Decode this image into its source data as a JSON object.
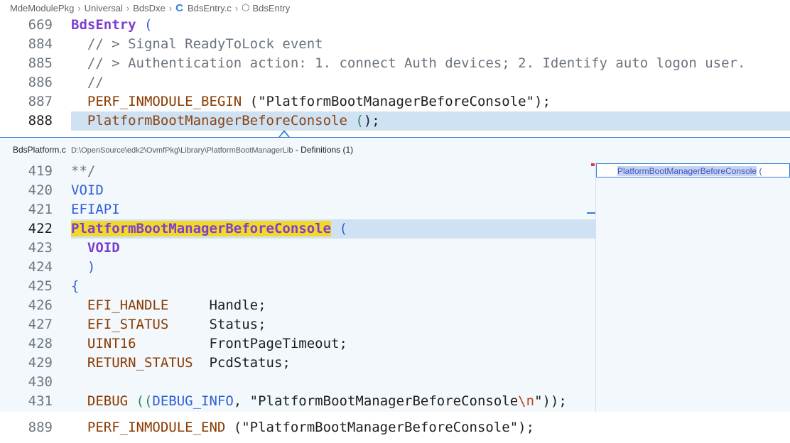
{
  "breadcrumb": {
    "items": [
      "MdeModulePkg",
      "Universal",
      "BdsDxe",
      "BdsEntry.c",
      "BdsEntry"
    ],
    "file_icon": "c-file-icon",
    "symbol_icon": "symbol-cube-icon"
  },
  "editor_top": [
    {
      "num": "669",
      "parts": [
        {
          "t": "BdsEntry",
          "c": "kw-fn"
        },
        {
          "t": " (",
          "c": "paren"
        }
      ]
    },
    {
      "num": "884",
      "parts": [
        {
          "t": "  // > Signal ReadyToLock event",
          "c": "cmt"
        }
      ]
    },
    {
      "num": "885",
      "parts": [
        {
          "t": "  // > Authentication action: 1. connect Auth devices; 2. Identify auto logon user.",
          "c": "cmt"
        }
      ]
    },
    {
      "num": "886",
      "parts": [
        {
          "t": "  //",
          "c": "cmt"
        }
      ]
    },
    {
      "num": "887",
      "parts": [
        {
          "t": "  PERF_INMODULE_BEGIN",
          "c": "macro"
        },
        {
          "t": " (\"PlatformBootManagerBeforeConsole\");",
          "c": "txt"
        }
      ]
    },
    {
      "num": "888",
      "parts": [
        {
          "t": "  PlatformBootManagerBeforeConsole",
          "c": "fnref"
        },
        {
          "t": " (",
          "c": "paren-g"
        },
        {
          "t": ");",
          "c": "txt"
        }
      ],
      "current": true
    }
  ],
  "peek": {
    "file": "BdsPlatform.c",
    "path": "D:\\OpenSource\\edk2\\OvmfPkg\\Library\\PlatformBootManagerLib",
    "defs": " - Definitions (1)",
    "lines": [
      {
        "num": "419",
        "parts": [
          {
            "t": "**/",
            "c": "cmt"
          }
        ]
      },
      {
        "num": "420",
        "parts": [
          {
            "t": "VOID",
            "c": "paren"
          }
        ]
      },
      {
        "num": "421",
        "parts": [
          {
            "t": "EFIAPI",
            "c": "paren"
          }
        ]
      },
      {
        "num": "422",
        "parts": [
          {
            "t": "PlatformBootManagerBeforeConsole",
            "c": "sym-hl"
          },
          {
            "t": " (",
            "c": "paren"
          }
        ],
        "current": true
      },
      {
        "num": "423",
        "parts": [
          {
            "t": "  VOID",
            "c": "kw-fn"
          }
        ]
      },
      {
        "num": "424",
        "parts": [
          {
            "t": "  )",
            "c": "paren"
          }
        ]
      },
      {
        "num": "425",
        "parts": [
          {
            "t": "{",
            "c": "paren"
          }
        ]
      },
      {
        "num": "426",
        "parts": [
          {
            "t": "  EFI_HANDLE",
            "c": "macro"
          },
          {
            "t": "     Handle;",
            "c": "txt"
          }
        ]
      },
      {
        "num": "427",
        "parts": [
          {
            "t": "  EFI_STATUS",
            "c": "macro"
          },
          {
            "t": "     Status;",
            "c": "txt"
          }
        ]
      },
      {
        "num": "428",
        "parts": [
          {
            "t": "  UINT16",
            "c": "macro"
          },
          {
            "t": "         FrontPageTimeout;",
            "c": "txt"
          }
        ]
      },
      {
        "num": "429",
        "parts": [
          {
            "t": "  RETURN_STATUS",
            "c": "macro"
          },
          {
            "t": "  PcdStatus;",
            "c": "txt"
          }
        ]
      },
      {
        "num": "430",
        "parts": []
      },
      {
        "num": "431",
        "parts": [
          {
            "t": "  DEBUG",
            "c": "macro"
          },
          {
            "t": " ((",
            "c": "paren-g"
          },
          {
            "t": "DEBUG_INFO",
            "c": "paren"
          },
          {
            "t": ", \"PlatformBootManagerBeforeConsole",
            "c": "txt"
          },
          {
            "t": "\\n",
            "c": "esc"
          },
          {
            "t": "\"));",
            "c": "txt"
          }
        ]
      }
    ],
    "reference": {
      "match": "PlatformBootManagerBeforeConsole",
      "rest": " ("
    }
  },
  "editor_bottom": [
    {
      "num": "889",
      "parts": [
        {
          "t": "  PERF_INMODULE_END",
          "c": "macro"
        },
        {
          "t": " (\"PlatformBootManagerBeforeConsole\");",
          "c": "txt"
        }
      ]
    }
  ]
}
